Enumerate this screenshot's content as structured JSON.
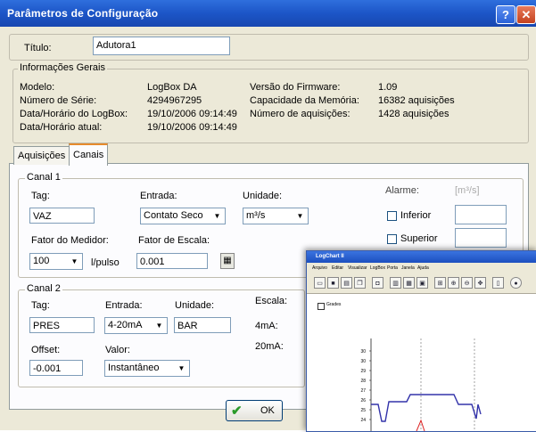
{
  "window": {
    "title": "Parâmetros de Configuração",
    "help": "?",
    "close": "✕"
  },
  "titulo": {
    "label": "Título:",
    "value": "Adutora1"
  },
  "info": {
    "legend": "Informações Gerais",
    "rows_left": [
      {
        "label": "Modelo:",
        "value": "LogBox DA"
      },
      {
        "label": "Número de Série:",
        "value": "4294967295"
      },
      {
        "label": "Data/Horário do LogBox:",
        "value": "19/10/2006 09:14:49"
      },
      {
        "label": "Data/Horário atual:",
        "value": "19/10/2006 09:14:49"
      }
    ],
    "rows_right": [
      {
        "label": "Versão do Firmware:",
        "value": "1.09"
      },
      {
        "label": "Capacidade da Memória:",
        "value": "16382 aquisições"
      },
      {
        "label": "Número de aquisições:",
        "value": "1428 aquisições"
      }
    ]
  },
  "tabs": [
    {
      "label": "Aquisições"
    },
    {
      "label": "Canais"
    }
  ],
  "canal1": {
    "legend": "Canal 1",
    "tag_label": "Tag:",
    "tag_value": "VAZ",
    "entrada_label": "Entrada:",
    "entrada_value": "Contato Seco",
    "unidade_label": "Unidade:",
    "unidade_value": "m³/s",
    "alarme_label": "Alarme:",
    "alarme_unit": "[m³/s]",
    "inferior_label": "Inferior",
    "superior_label": "Superior",
    "fator_medidor_label": "Fator do Medidor:",
    "fator_medidor_value": "100",
    "fator_unit": "l/pulso",
    "fator_escala_label": "Fator de Escala:",
    "fator_escala_value": "0.001"
  },
  "canal2": {
    "legend": "Canal 2",
    "tag_label": "Tag:",
    "tag_value": "PRES",
    "entrada_label": "Entrada:",
    "entrada_value": "4-20mA",
    "unidade_label": "Unidade:",
    "unidade_value": "BAR",
    "escala_label": "Escala:",
    "escala_4": "4mA:",
    "escala_20": "20mA:",
    "offset_label": "Offset:",
    "offset_value": "-0.001",
    "valor_label": "Valor:",
    "valor_value": "Instantâneo"
  },
  "ok_label": "OK",
  "logchart": {
    "title": "LogChart II",
    "menu": [
      "Arquivo",
      "Editar",
      "Visualizar",
      "LogBox",
      "Porta",
      "Janela",
      "Ajuda"
    ],
    "grades_label": "Grades",
    "yticks": [
      "30",
      "30",
      "29",
      "28",
      "27",
      "26",
      "25",
      "24"
    ],
    "series_color": "#3333aa",
    "series2_color": "#dd2222"
  }
}
